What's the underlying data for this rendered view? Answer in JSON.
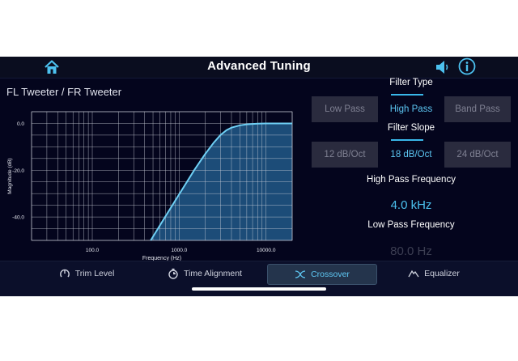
{
  "header": {
    "title": "Advanced Tuning",
    "icons": [
      "home-icon",
      "speaker-icon",
      "info-icon"
    ]
  },
  "channel": "FL Tweeter / FR Tweeter",
  "chart_data": {
    "type": "area",
    "title": "",
    "xlabel": "Frequency (Hz)",
    "ylabel": "Magnitude (dB)",
    "x_scale": "log",
    "xlim": [
      20,
      20000
    ],
    "ylim": [
      -50,
      5
    ],
    "x_ticks": [
      100,
      1000,
      10000
    ],
    "x_tick_labels": [
      "100.0",
      "1000.0",
      "10000.0"
    ],
    "y_ticks": [
      0,
      -20,
      -40
    ],
    "y_tick_labels": [
      "0.0",
      "-20.0",
      "-40.0"
    ],
    "grid": true,
    "series": [
      {
        "x": [
          470,
          700,
          1000,
          1500,
          2000,
          2500,
          3000,
          3500,
          4000,
          5000,
          6000,
          8000,
          10000,
          15000,
          20000
        ],
        "y": [
          -50,
          -39.6,
          -30.3,
          -19.8,
          -13.0,
          -8.2,
          -4.9,
          -2.9,
          -1.8,
          -0.8,
          -0.4,
          -0.1,
          0,
          0,
          0
        ]
      }
    ],
    "colors": {
      "fill": "#1c4c78",
      "line": "#6fd0f5",
      "grid": "#cfd3dc",
      "plot_bg": "#04051d"
    }
  },
  "filter_type": {
    "label": "Filter Type",
    "options": [
      "Low Pass",
      "High Pass",
      "Band Pass"
    ],
    "selected": "High Pass"
  },
  "filter_slope": {
    "label": "Filter Slope",
    "options": [
      "12 dB/Oct",
      "18 dB/Oct",
      "24 dB/Oct"
    ],
    "selected": "18 dB/Oct"
  },
  "high_pass": {
    "label": "High Pass Frequency",
    "value": "4.0 kHz"
  },
  "low_pass": {
    "label": "Low Pass Frequency",
    "value": "80.0 Hz"
  },
  "tabs": [
    {
      "label": "Trim Level",
      "icon": "knob-icon",
      "active": false
    },
    {
      "label": "Time Alignment",
      "icon": "stopwatch-icon",
      "active": false
    },
    {
      "label": "Crossover",
      "icon": "crossover-icon",
      "active": true
    },
    {
      "label": "Equalizer",
      "icon": "equalizer-icon",
      "active": false
    }
  ],
  "colors": {
    "accent": "#4cc1ef",
    "background": "#04051d",
    "header": "#0a0d1f",
    "button": "#2a2b3e"
  }
}
